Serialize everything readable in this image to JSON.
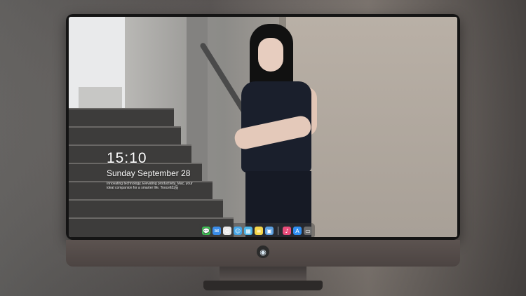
{
  "desktop": {
    "time": "15:10",
    "date": "Sunday September 28",
    "tagline": "Innovating technology, Elevating productivity. Mac, your ideal companion for a smarter life. Toocell出品"
  },
  "dock": {
    "items": [
      {
        "name": "messages",
        "icon": "💬",
        "color": "#3fbf55"
      },
      {
        "name": "mail",
        "icon": "✉",
        "color": "#3a8ce8"
      },
      {
        "name": "safari",
        "icon": "⊙",
        "color": "#e9e9e9"
      },
      {
        "name": "finder",
        "icon": "☺",
        "color": "#45a5e6"
      },
      {
        "name": "claquette",
        "icon": "▦",
        "color": "#4db5e8"
      },
      {
        "name": "notes",
        "icon": "≡",
        "color": "#f5d64b"
      },
      {
        "name": "preview",
        "icon": "▣",
        "color": "#5b9fe0"
      },
      {
        "name": "music",
        "icon": "♪",
        "color": "#e94c7a"
      },
      {
        "name": "app-store",
        "icon": "A",
        "color": "#2f8ef0"
      },
      {
        "name": "downloads",
        "icon": "▭",
        "color": "#6b6b6b"
      }
    ]
  },
  "monitor": {
    "logo_icon": "◉"
  }
}
